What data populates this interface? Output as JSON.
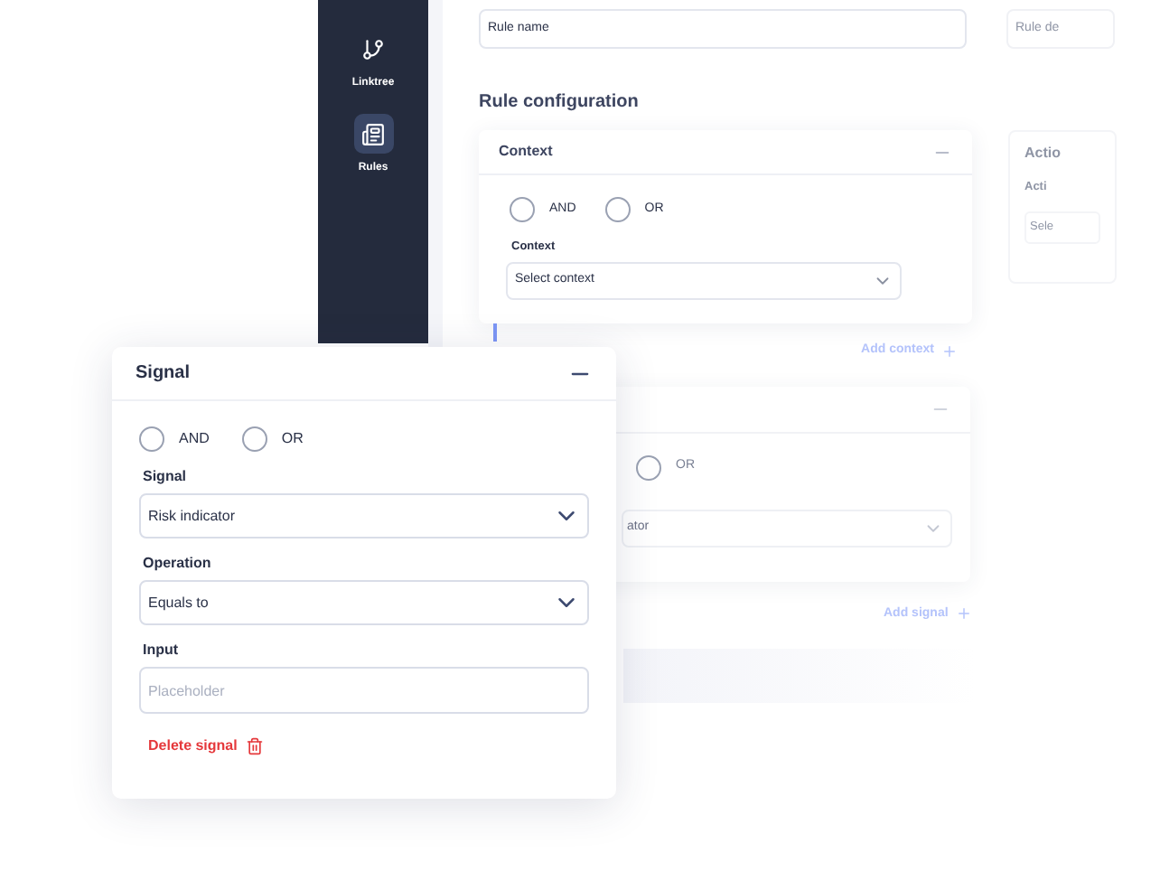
{
  "sidebar": {
    "items": [
      {
        "label": "Linktree",
        "selected": false
      },
      {
        "label": "Rules",
        "selected": true
      }
    ]
  },
  "rule_form": {
    "name_value": "Rule name",
    "description_placeholder": "Rule de",
    "section_title": "Rule configuration",
    "context_card": {
      "title": "Context",
      "radios": [
        {
          "label": "AND",
          "selected": false
        },
        {
          "label": "OR",
          "selected": false
        }
      ],
      "field_label": "Context",
      "field_placeholder": "Select context"
    },
    "add_context": "Add context",
    "action_card": {
      "title": "Actio",
      "field_label": "Acti",
      "field_placeholder": "Sele"
    },
    "signal_card_behind": {
      "radios": [
        {
          "label": "OR",
          "selected": false
        }
      ],
      "field_value": "ator"
    },
    "add_signal": "Add signal"
  },
  "signal_card": {
    "title": "Signal",
    "radios": [
      {
        "label": "AND",
        "selected": false
      },
      {
        "label": "OR",
        "selected": false
      }
    ],
    "fields": [
      {
        "kind": "select",
        "label": "Signal",
        "value": "Risk indicator"
      },
      {
        "kind": "select",
        "label": "Operation",
        "value": "Equals to"
      },
      {
        "kind": "input",
        "label": "Input",
        "placeholder": "Placeholder"
      }
    ],
    "delete_label": "Delete signal"
  }
}
